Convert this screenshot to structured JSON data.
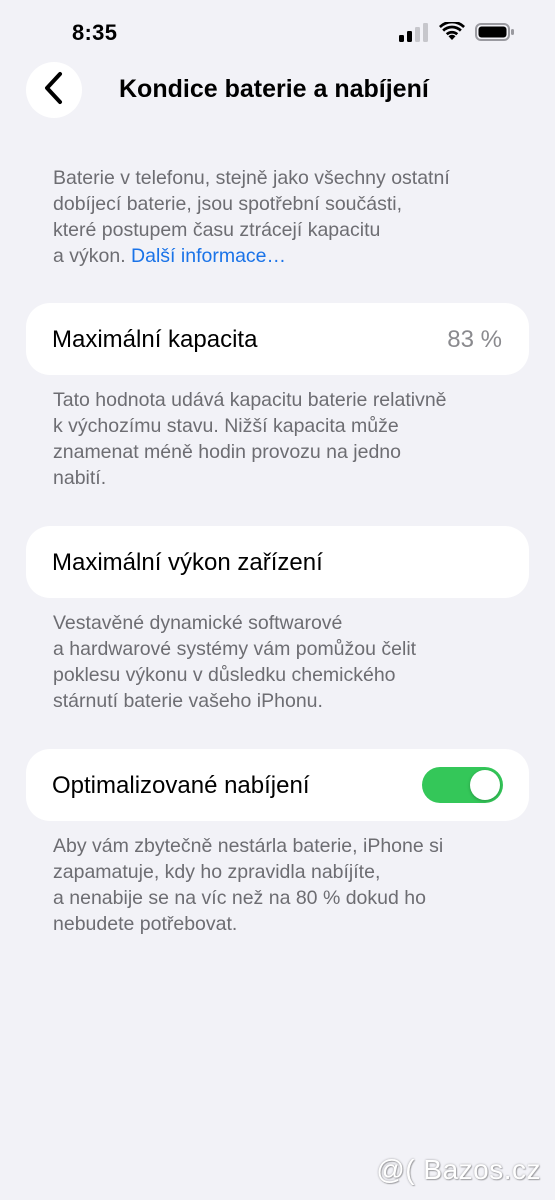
{
  "status_bar": {
    "time": "8:35",
    "icons": [
      "signal-icon",
      "wifi-icon",
      "battery-icon"
    ]
  },
  "nav": {
    "back_icon": "chevron-left-icon",
    "title": "Kondice baterie a nabíjení"
  },
  "intro": {
    "text_lines": [
      "Baterie v telefonu, stejně jako všechny ostatní",
      "dobíjecí baterie, jsou spotřební součásti,",
      "které postupem času ztrácejí kapacitu"
    ],
    "last_line_prefix": "a výkon. ",
    "link_label": "Další informace…"
  },
  "max_capacity": {
    "label": "Maximální kapacita",
    "value": "83 %",
    "footer_lines": [
      "Tato hodnota udává kapacitu baterie relativně",
      "k výchozímu stavu. Nižší kapacita může",
      "znamenat méně hodin provozu na jedno",
      "nabití."
    ]
  },
  "peak_performance": {
    "label": "Maximální výkon zařízení",
    "footer_lines": [
      "Vestavěné dynamické softwarové",
      "a hardwarové systémy vám pomůžou čelit",
      "poklesu výkonu v důsledku chemického",
      "stárnutí baterie vašeho iPhonu."
    ]
  },
  "optimized_charging": {
    "label": "Optimalizované nabíjení",
    "toggle_on": true,
    "footer_lines": [
      "Aby vám zbytečně nestárla baterie, iPhone si",
      "zapamatuje, kdy ho zpravidla nabíjíte,",
      "a nenabije se na víc než na 80 % dokud ho",
      "nebudete potřebovat."
    ]
  },
  "colors": {
    "background": "#f2f2f7",
    "link": "#1a73e8",
    "toggle_on": "#34c759",
    "secondary_text": "#6d6d72"
  },
  "watermark": {
    "text": "@( Bazos.cz"
  }
}
